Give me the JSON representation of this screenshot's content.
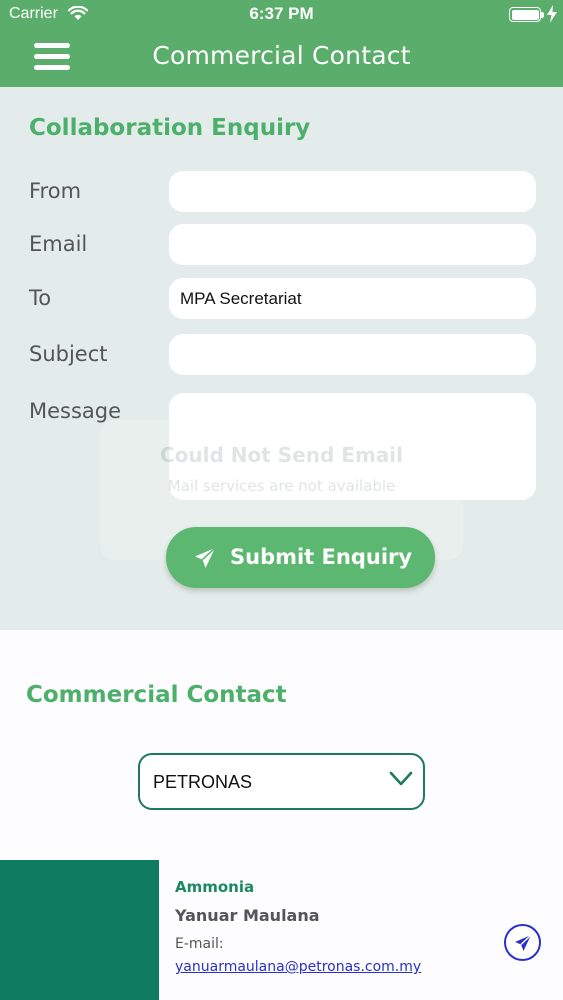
{
  "status_bar": {
    "carrier": "Carrier",
    "time": "6:37 PM"
  },
  "navbar": {
    "title": "Commercial Contact",
    "menu_icon": "hamburger-menu-icon"
  },
  "enquiry": {
    "heading": "Collaboration Enquiry",
    "fields": {
      "from_label": "From",
      "from_value": "",
      "email_label": "Email",
      "email_value": "",
      "to_label": "To",
      "to_value": "MPA Secretariat",
      "subject_label": "Subject",
      "subject_value": "",
      "message_label": "Message",
      "message_value": ""
    },
    "submit_label": "Submit Enquiry",
    "submit_icon": "paper-plane-icon"
  },
  "alert": {
    "title": "Could Not Send Email",
    "message": "Mail services are not available"
  },
  "contact": {
    "heading": "Commercial Contact",
    "company_selected": "PETRONAS",
    "card": {
      "category": "Ammonia",
      "name": "Yanuar Maulana",
      "email_label": "E-mail:",
      "email": "yanuarmaulana@petronas.com.my"
    }
  },
  "colors": {
    "primary_green": "#5aad6a",
    "heading_green": "#4cb06a",
    "dark_green": "#0e7c5f",
    "link_blue": "#2a30c9",
    "enquiry_bg": "#e3ecea"
  }
}
